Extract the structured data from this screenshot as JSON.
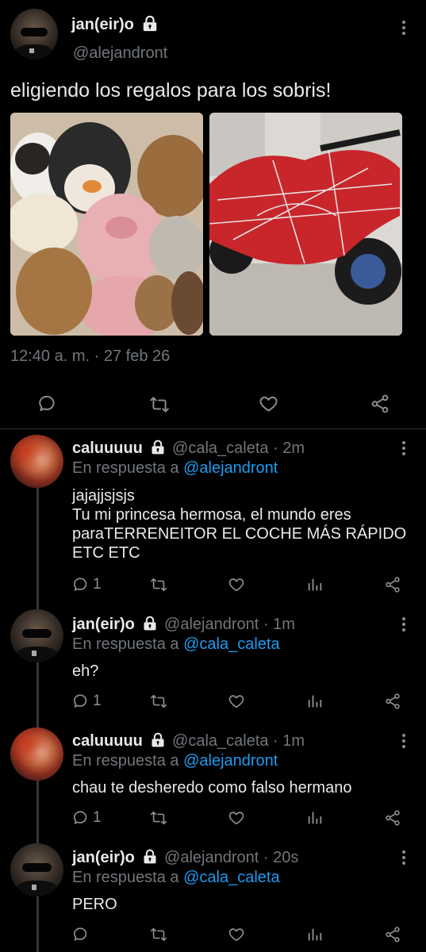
{
  "main_tweet": {
    "name": "jan(eir)o",
    "handle": "@alejandront",
    "text": "eligiendo los regalos para los sobris!",
    "timestamp": "12:40 a. m. · 27 feb 26"
  },
  "replies": [
    {
      "name": "caluuuuu",
      "meta": "@cala_caleta · 2m",
      "replying_prefix": "En respuesta a ",
      "replying_to": "@alejandront",
      "text": "jajajjsjsjs\nTu mi princesa hermosa, el mundo eres\nparaTERRENEITOR EL COCHE MÁS RÁPIDO\nETC ETC",
      "reply_count": "1"
    },
    {
      "name": "jan(eir)o",
      "meta": "@alejandront · 1m",
      "replying_prefix": "En respuesta a ",
      "replying_to": "@cala_caleta",
      "text": "eh?",
      "reply_count": "1"
    },
    {
      "name": "caluuuuu",
      "meta": "@cala_caleta · 1m",
      "replying_prefix": "En respuesta a ",
      "replying_to": "@alejandront",
      "text": "chau te desheredo como falso hermano",
      "reply_count": "1"
    },
    {
      "name": "jan(eir)o",
      "meta": "@alejandront · 20s",
      "replying_prefix": "En respuesta a ",
      "replying_to": "@cala_caleta",
      "text": "PERO",
      "reply_count": ""
    }
  ],
  "icons": {
    "reply": "reply-icon",
    "retweet": "retweet-icon",
    "like": "like-icon",
    "share": "share-icon",
    "analytics": "analytics-icon",
    "lock": "lock-icon",
    "more": "more-icon"
  },
  "colors": {
    "background": "#000000",
    "text": "#e7e9ea",
    "secondary": "#71767b",
    "link": "#1d9bf0",
    "divider": "#2f3336"
  }
}
